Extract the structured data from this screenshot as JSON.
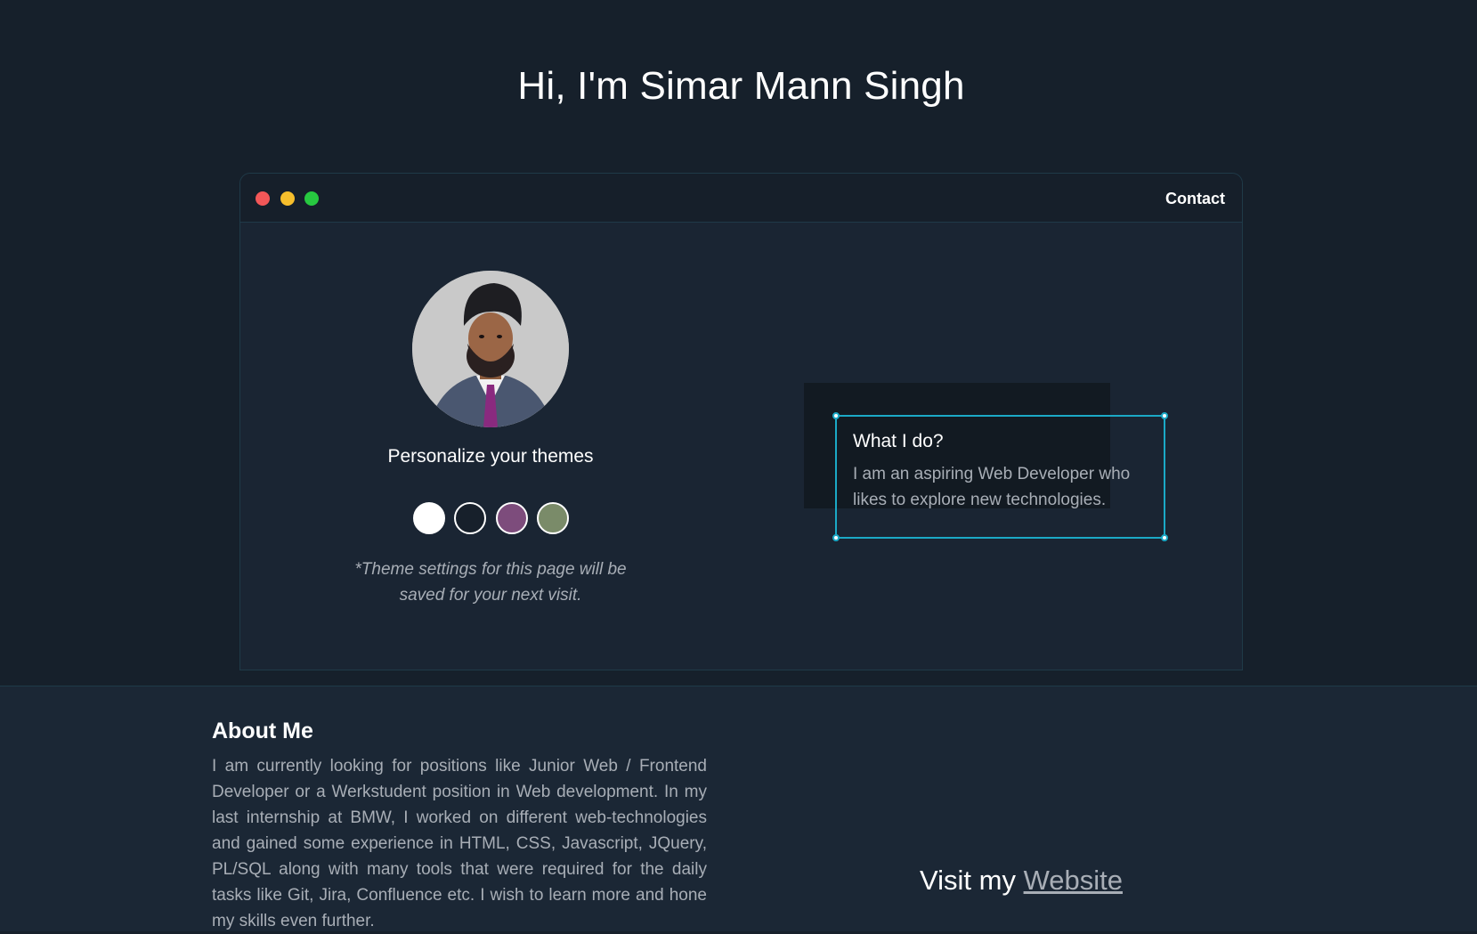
{
  "header": {
    "title": "Hi, I'm Simar Mann Singh"
  },
  "window": {
    "controls": [
      "close",
      "minimize",
      "maximize"
    ],
    "control_colors": [
      "#f25758",
      "#f6be2c",
      "#27c840"
    ],
    "nav": {
      "contact_label": "Contact"
    }
  },
  "profile": {
    "avatar_icon": "profile-photo",
    "theme_heading": "Personalize your themes",
    "swatches": [
      {
        "name": "light-theme",
        "color": "#ffffff"
      },
      {
        "name": "dark-theme",
        "color": "#17202b"
      },
      {
        "name": "purple-theme",
        "color": "#7d4c7c"
      },
      {
        "name": "green-theme",
        "color": "#7a8b69"
      }
    ],
    "theme_note": "*Theme settings for this page will be saved for your next visit."
  },
  "what_i_do": {
    "title": "What I do?",
    "text": "I am an aspiring Web Developer who likes to explore new technologies."
  },
  "about": {
    "title": "About Me",
    "text": "I am currently looking for positions like Junior Web / Frontend Developer or a Werkstudent position in Web development. In my last internship at BMW, I worked on different web-technologies and gained some experience in HTML, CSS, Javascript, JQuery, PL/SQL along with many tools that were required for the daily tasks like Git, Jira, Confluence etc. I wish to learn more and hone my skills even further."
  },
  "visit": {
    "prefix": "Visit my ",
    "link_label": "Website"
  },
  "colors": {
    "accent": "#1ba9c6",
    "background": "#17202b",
    "muted_text": "#a8aeb6"
  }
}
